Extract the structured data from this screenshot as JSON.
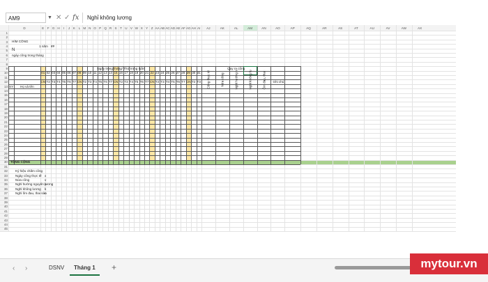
{
  "formula_bar": {
    "name_box": "AM9",
    "cancel_icon": "cancel-icon",
    "enter_icon": "check-icon",
    "function_icon": "fx",
    "formula": "Nghỉ không lương"
  },
  "columns": [
    "D",
    "E",
    "F",
    "G",
    "H",
    "I",
    "J",
    "K",
    "L",
    "M",
    "N",
    "O",
    "P",
    "Q",
    "R",
    "S",
    "T",
    "U",
    "V",
    "W",
    "X",
    "Y",
    "Z",
    "AA",
    "AB",
    "AC",
    "AD",
    "AE",
    "AF",
    "AG",
    "AH",
    "AI",
    "AJ",
    "AK",
    "AL",
    "AM",
    "AN",
    "AO",
    "AP",
    "AQ",
    "AR",
    "AS",
    "AT",
    "AU",
    "AV",
    "AW",
    "AX"
  ],
  "selected_column": "AM",
  "rows": [
    "1",
    "2",
    "3",
    "4",
    "5",
    "6",
    "7",
    "8",
    "9",
    "10",
    "11",
    "12",
    "13",
    "14",
    "15",
    "16",
    "17",
    "18",
    "19",
    "20",
    "21",
    "22",
    "23",
    "24",
    "25",
    "26",
    "27",
    "28",
    "29",
    "30",
    "31",
    "32",
    "33",
    "34",
    "35",
    "36",
    "37",
    "38",
    "39",
    "40",
    "41",
    "42",
    "43",
    "44",
    "45"
  ],
  "sheet": {
    "title": "HÍM CÔNG",
    "month_label": "1 năm",
    "month_value": "##",
    "company_marker": "N",
    "workdays_note": "ngày công trong tháng",
    "col_stt": "SY",
    "col_name": "Họ và tên",
    "header_days": "Ngày trong tháng/ Thứ trong tuần",
    "header_summary": "Quy ra công",
    "days": [
      "01",
      "02",
      "03",
      "04",
      "05",
      "06",
      "07",
      "08",
      "09",
      "10",
      "11",
      "12",
      "13",
      "14",
      "15",
      "16",
      "17",
      "18",
      "19",
      "20",
      "21",
      "22",
      "23",
      "24",
      "25",
      "26",
      "27",
      "28",
      "29",
      "30",
      "31"
    ],
    "weekdays": [
      "CN",
      "T2",
      "T3",
      "T4",
      "T5",
      "T6",
      "T7",
      "CN",
      "T2",
      "T3",
      "T4",
      "T5",
      "T6",
      "T7",
      "CN",
      "T2",
      "T3",
      "T4",
      "T5",
      "T6",
      "T7",
      "CN",
      "T2",
      "T3",
      "T4",
      "T5",
      "T6",
      "T7",
      "CN",
      "T2",
      "T3"
    ],
    "summary_cols": [
      "Công thực tế",
      "Nửa công",
      "Nghỉ hưởng lương",
      "Nghỉ không lương",
      "Ốm đau, thai sản"
    ],
    "notes_col": "Ghi chú",
    "total_label": "TỔNG CỘNG",
    "legend_title": "Ký hiệu chấm công",
    "legend": [
      {
        "label": "Ngày công thực tế",
        "code": "x"
      },
      {
        "label": "Nửa công",
        "code": "v"
      },
      {
        "label": "Nghỉ hưởng nguyên lương",
        "code": "p"
      },
      {
        "label": "Nghỉ không lương",
        "code": "k"
      },
      {
        "label": "Nghỉ ốm đau, thai sản",
        "code": "o"
      }
    ]
  },
  "tabs": {
    "prev_icon": "chevron-left-icon",
    "next_icon": "chevron-right-icon",
    "items": [
      "DSNV",
      "Tháng 1"
    ],
    "active": "Tháng 1",
    "add_icon": "plus-icon"
  },
  "watermark": "mytour.vn",
  "colors": {
    "sunday_fill": "#fde7a6",
    "total_row_fill": "#a9d18e",
    "selected_header": "#d3ecd9",
    "selected_border": "#1a7340",
    "gridline": "#e3e3e3",
    "watermark_bg": "#d92f3a"
  }
}
